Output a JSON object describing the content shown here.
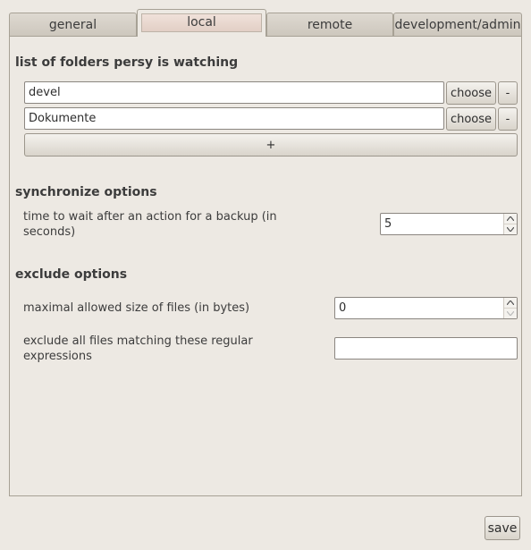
{
  "tabs": [
    {
      "label": "general"
    },
    {
      "label": "local"
    },
    {
      "label": "remote"
    },
    {
      "label": "development/admin"
    }
  ],
  "watch": {
    "title": "list of folders persy is watching",
    "folders": [
      {
        "value": "devel",
        "choose_label": "choose",
        "remove_label": "-"
      },
      {
        "value": "Dokumente",
        "choose_label": "choose",
        "remove_label": "-"
      }
    ],
    "add_label": "+"
  },
  "sync": {
    "title": "synchronize options",
    "wait_label": "time to wait after an action for a backup (in seconds)",
    "wait_value": "5"
  },
  "exclude": {
    "title": "exclude options",
    "max_size_label": "maximal allowed size of files (in bytes)",
    "max_size_value": "0",
    "regex_label": "exclude all files matching these regular expressions",
    "regex_value": ""
  },
  "footer": {
    "save_label": "save"
  }
}
